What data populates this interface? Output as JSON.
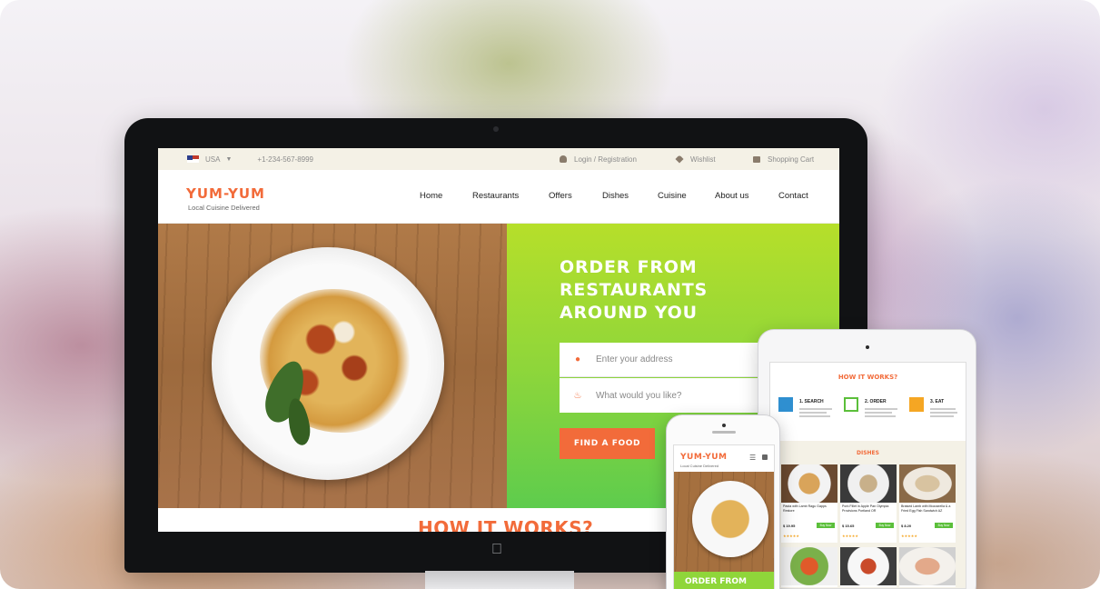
{
  "colors": {
    "accent": "#f26b3a",
    "green": "#8fd63a",
    "topbar_bg": "#f4f1e6"
  },
  "desktop": {
    "topbar": {
      "country": "USA",
      "phone": "+1-234-567-8999",
      "login": "Login / Registration",
      "wishlist": "Wishlist",
      "cart": "Shopping Cart"
    },
    "brand": {
      "logo": "YUM-YUM",
      "tagline": "Local Cuisine Delivered"
    },
    "nav": [
      "Home",
      "Restaurants",
      "Offers",
      "Dishes",
      "Cuisine",
      "About us",
      "Contact"
    ],
    "hero": {
      "title_lines": [
        "ORDER FROM",
        "RESTAURANTS",
        "AROUND YOU"
      ],
      "address_placeholder": "Enter your address",
      "food_placeholder": "What would you like?",
      "button": "FIND A FOOD"
    },
    "how_it_works": "HOW IT WORKS?"
  },
  "tablet": {
    "how_it_works": "HOW IT WORKS?",
    "steps": [
      "1. SEARCH",
      "2. ORDER",
      "3. EAT"
    ],
    "dishes_heading": "DISHES",
    "cards": [
      {
        "name": "Pasta with Lamb Ragu Gapps Restore",
        "price": "$ 19.95",
        "button": "Buy Now"
      },
      {
        "name": "Pork Fillet in Apple Pan Olympia Provisions Portland OR",
        "price": "$ 15.65",
        "button": "Buy Now"
      },
      {
        "name": "Braised Lamb with Mozzarella & a Fried Egg Fish Sandwich AZ",
        "price": "$ 8.20",
        "button": "Buy Now"
      }
    ]
  },
  "phone": {
    "logo": "YUM-YUM",
    "tagline": "Local Cuisine Delivered",
    "hero_text": "ORDER FROM"
  }
}
